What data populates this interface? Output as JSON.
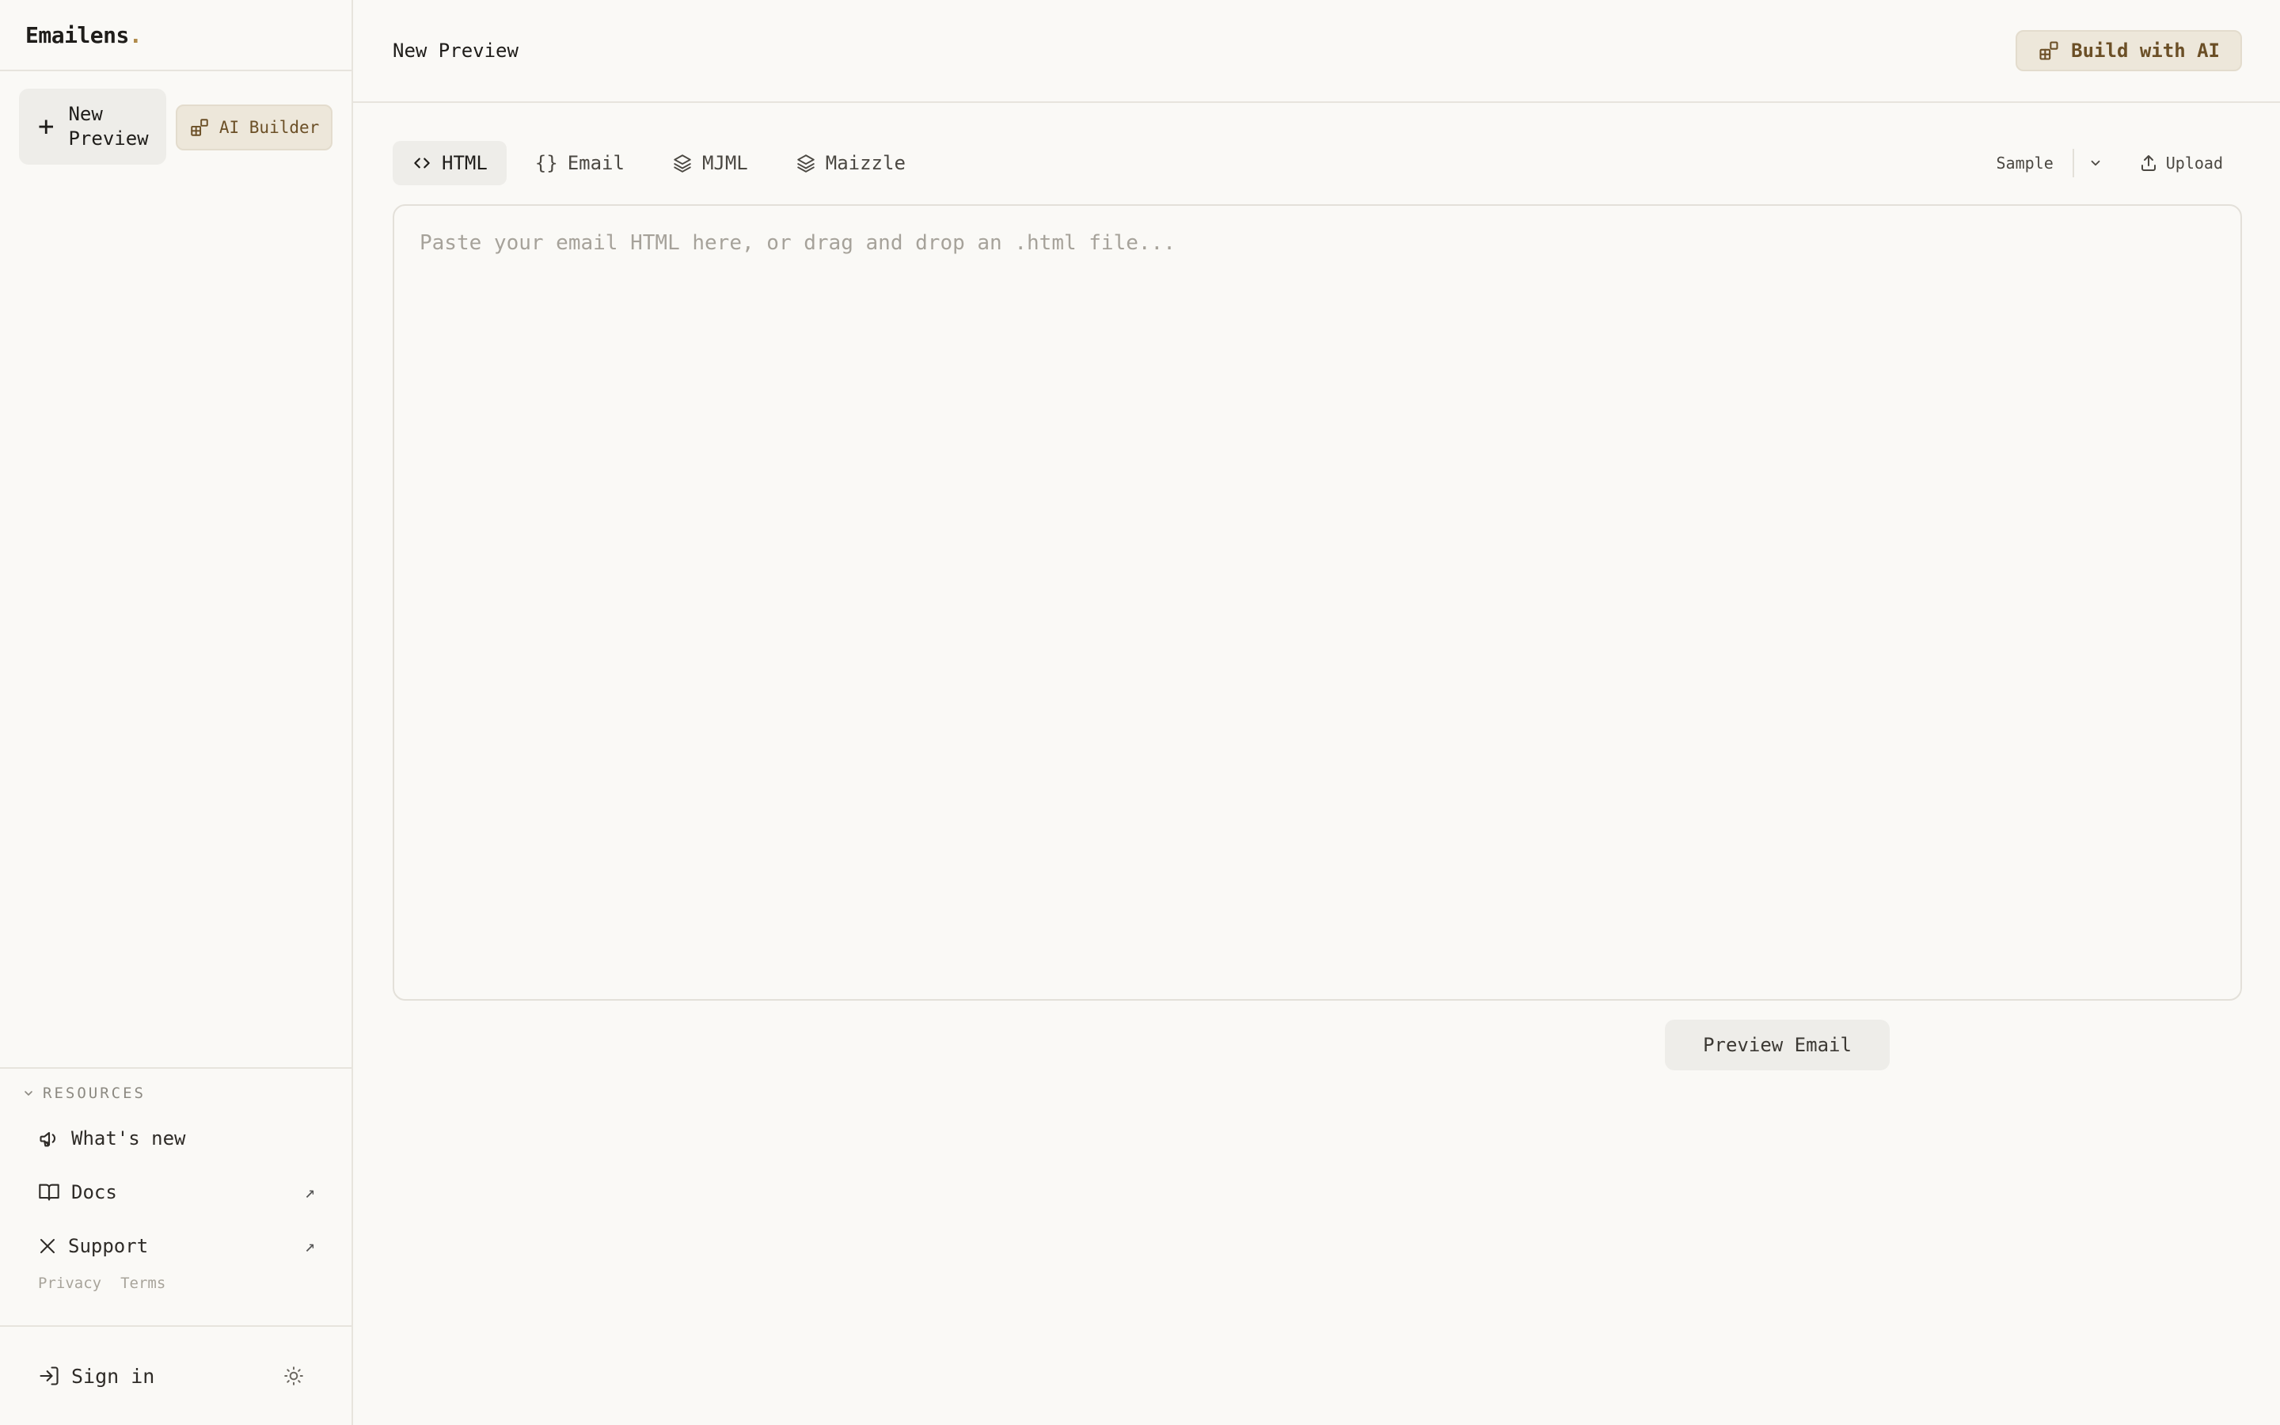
{
  "brand": {
    "name": "Emailens",
    "dot": "."
  },
  "sidebar": {
    "new_preview": "New\nPreview",
    "ai_builder": "AI Builder",
    "resources_heading": "RESOURCES",
    "items": [
      {
        "label": "What's new",
        "icon": "megaphone-icon",
        "external": false
      },
      {
        "label": "Docs",
        "icon": "book-icon",
        "external": true
      },
      {
        "label": "Support",
        "icon": "x-logo-icon",
        "external": true
      }
    ],
    "legal": {
      "privacy": "Privacy",
      "terms": "Terms"
    },
    "sign_in": "Sign in"
  },
  "header": {
    "title": "New Preview",
    "build_ai": "Build with AI"
  },
  "tabs": [
    {
      "label": "HTML",
      "icon": "code-icon",
      "active": true
    },
    {
      "label": "Email",
      "icon": "braces-icon",
      "active": false
    },
    {
      "label": "MJML",
      "icon": "layers-icon",
      "active": false
    },
    {
      "label": "Maizzle",
      "icon": "layers-icon",
      "active": false
    }
  ],
  "tools": {
    "sample": "Sample",
    "upload": "Upload"
  },
  "editor": {
    "placeholder": "Paste your email HTML here, or drag and drop an .html file..."
  },
  "actions": {
    "preview": "Preview Email"
  },
  "colors": {
    "accent": "#6b4f26",
    "background": "#faf9f6",
    "border": "#e7e4dd"
  }
}
